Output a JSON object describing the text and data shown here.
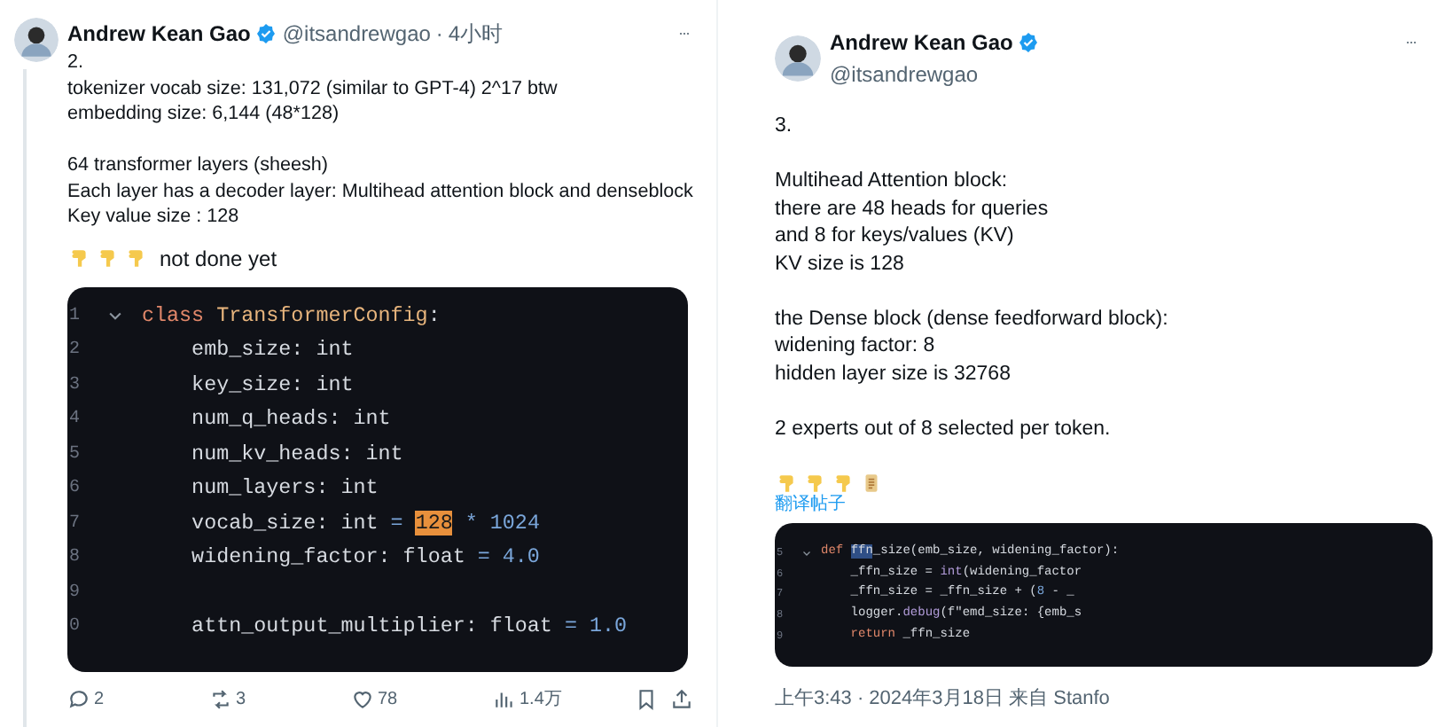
{
  "tweets": [
    {
      "author": "Andrew Kean Gao",
      "verified": true,
      "handle": "@itsandrewgao",
      "separator": "·",
      "time": "4小时",
      "kind": "thread",
      "paragraphs": [
        [
          "2.",
          "tokenizer vocab size: 131,072 (similar to GPT-4) 2^17 btw",
          "embedding size: 6,144 (48*128)"
        ],
        [
          "64 transformer layers (sheesh)",
          "Each layer has a decoder layer: Multihead attention block and denseblock",
          "Key value size : 128"
        ]
      ],
      "emoji": {
        "icons": [
          {
            "kind": "hand"
          },
          {
            "kind": "hand"
          },
          {
            "kind": "hand"
          }
        ],
        "text": "not done yet"
      },
      "code": {
        "lines": [
          {
            "number": "1",
            "fold": true,
            "tokens": [
              {
                "text": "class ",
                "kind": "keyword"
              },
              {
                "text": "TransformerConfig",
                "kind": "classname"
              },
              {
                "text": ":",
                "kind": "plain"
              }
            ]
          },
          {
            "number": "2",
            "fold": false,
            "tokens": [
              {
                "text": "    emb_size: int",
                "kind": "plain"
              }
            ]
          },
          {
            "number": "3",
            "fold": false,
            "tokens": [
              {
                "text": "    key_size: int",
                "kind": "plain"
              }
            ]
          },
          {
            "number": "4",
            "fold": false,
            "tokens": [
              {
                "text": "    num_q_heads: int",
                "kind": "plain"
              }
            ]
          },
          {
            "number": "5",
            "fold": false,
            "tokens": [
              {
                "text": "    num_kv_heads: int",
                "kind": "plain"
              }
            ]
          },
          {
            "number": "6",
            "fold": false,
            "tokens": [
              {
                "text": "    num_layers: int",
                "kind": "plain"
              }
            ]
          },
          {
            "number": "7",
            "fold": false,
            "tokens": [
              {
                "text": "    vocab_size: int ",
                "kind": "plain"
              },
              {
                "text": "= ",
                "kind": "number"
              },
              {
                "text": "128",
                "kind": "highlight"
              },
              {
                "text": " * 1024",
                "kind": "number"
              }
            ]
          },
          {
            "number": "8",
            "fold": false,
            "tokens": [
              {
                "text": "    widening_factor: float ",
                "kind": "plain"
              },
              {
                "text": "= 4.0",
                "kind": "number"
              }
            ]
          },
          {
            "number": "9",
            "fold": false
          },
          {
            "number": "0",
            "fold": false,
            "tokens": [
              {
                "text": "    attn_output_multiplier: float ",
                "kind": "plain"
              },
              {
                "text": "= 1.0",
                "kind": "number"
              }
            ]
          }
        ]
      },
      "actions": [
        {
          "kind": "reply",
          "count": "2"
        },
        {
          "kind": "repost",
          "count": "3"
        },
        {
          "kind": "like",
          "count": "78"
        },
        {
          "kind": "views",
          "count": "1.4万"
        },
        {
          "kind": "bookmark"
        },
        {
          "kind": "share"
        }
      ]
    },
    {
      "author": "Andrew Kean Gao",
      "verified": true,
      "handle": "@itsandrewgao",
      "kind": "detail",
      "paragraphs": [
        [
          "3."
        ],
        [
          "Multihead Attention block:",
          "there are 48 heads for queries",
          "and 8 for keys/values (KV)",
          "KV size is 128"
        ],
        [
          "the Dense block (dense feedforward block):",
          "widening factor: 8",
          "hidden layer size is 32768"
        ],
        [
          "2 experts out of 8 selected per token."
        ]
      ],
      "emoji": {
        "icons": [
          {
            "kind": "hand"
          },
          {
            "kind": "hand"
          },
          {
            "kind": "hand"
          },
          {
            "kind": "scroll"
          }
        ]
      },
      "translate": "翻译帖子",
      "code": {
        "lines": [
          {
            "number": "5",
            "fold": true,
            "tokens": [
              {
                "text": "def ",
                "kind": "keyword"
              },
              {
                "text": "ffn",
                "kind": "selected"
              },
              {
                "text": "_size(emb_size, widening_factor):",
                "kind": "plain"
              }
            ]
          },
          {
            "number": "6",
            "fold": false,
            "tokens": [
              {
                "text": "    _ffn_size = ",
                "kind": "plain"
              },
              {
                "text": "int",
                "kind": "builtin"
              },
              {
                "text": "(widening_factor",
                "kind": "plain"
              }
            ]
          },
          {
            "number": "7",
            "fold": false,
            "tokens": [
              {
                "text": "    _ffn_size = _ffn_size + (",
                "kind": "plain"
              },
              {
                "text": "8",
                "kind": "number"
              },
              {
                "text": " - _",
                "kind": "plain"
              }
            ]
          },
          {
            "number": "8",
            "fold": false,
            "tokens": [
              {
                "text": "    logger.",
                "kind": "plain"
              },
              {
                "text": "debug",
                "kind": "builtin"
              },
              {
                "text": "(f\"emd_size: {emb_s",
                "kind": "plain"
              }
            ]
          },
          {
            "number": "9",
            "fold": false,
            "tokens": [
              {
                "text": "    return",
                "kind": "keyword"
              },
              {
                "text": " _ffn_size",
                "kind": "plain"
              }
            ]
          }
        ]
      },
      "timestamp": "上午3:43 · 2024年3月18日 来自 Stanfo"
    }
  ]
}
